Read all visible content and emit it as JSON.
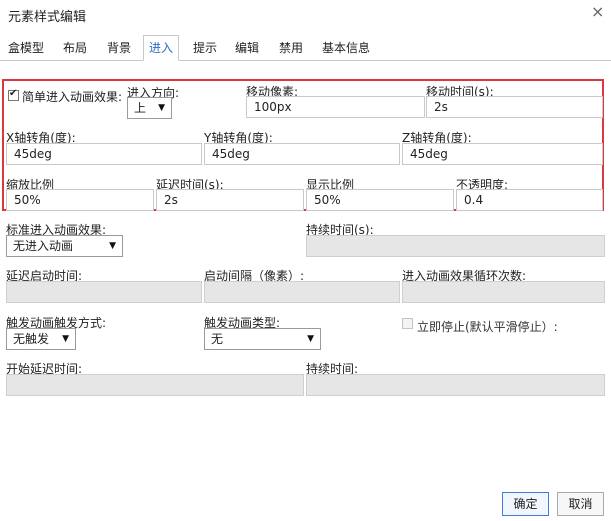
{
  "dialog": {
    "title": "元素样式编辑",
    "close_glyph": "×"
  },
  "tabs": [
    {
      "label": "盒模型"
    },
    {
      "label": "布局"
    },
    {
      "label": "背景"
    },
    {
      "label": "进入",
      "active": true
    },
    {
      "label": "提示"
    },
    {
      "label": "编辑"
    },
    {
      "label": "禁用"
    },
    {
      "label": "基本信息"
    }
  ],
  "simple_enter": {
    "checkbox_label": "简单进入动画效果:",
    "checked": true,
    "direction_label": "进入方向:",
    "direction_value": "上",
    "move_px_label": "移动像素:",
    "move_px_value": "100px",
    "move_time_label": "移动时间(s):",
    "move_time_value": "2s",
    "x_rot_label": "X轴转角(度):",
    "x_rot_value": "45deg",
    "y_rot_label": "Y轴转角(度):",
    "y_rot_value": "45deg",
    "z_rot_label": "Z轴转角(度):",
    "z_rot_value": "45deg",
    "scale_label": "缩放比例",
    "scale_value": "50%",
    "delay_label": "延迟时间(s):",
    "delay_value": "2s",
    "display_ratio_label": "显示比例",
    "display_ratio_value": "50%",
    "opacity_label": "不透明度:",
    "opacity_value": "0.4"
  },
  "standard": {
    "effect_label": "标准进入动画效果:",
    "effect_value": "无进入动画",
    "duration_label": "持续时间(s):",
    "duration_value": "",
    "delay_start_label": "延迟启动时间:",
    "interval_label": "启动间隔（像素）:",
    "loop_label": "进入动画效果循环次数:",
    "trigger_mode_label": "触发动画触发方式:",
    "trigger_mode_value": "无触发",
    "trigger_type_label": "触发动画类型:",
    "trigger_type_value": "无",
    "stop_label": "立即停止(默认平滑停止）:",
    "start_delay_label": "开始延迟时间:",
    "duration2_label": "持续时间:"
  },
  "footer": {
    "ok": "确定",
    "cancel": "取消"
  },
  "icons": {
    "dropdown": "▼"
  }
}
